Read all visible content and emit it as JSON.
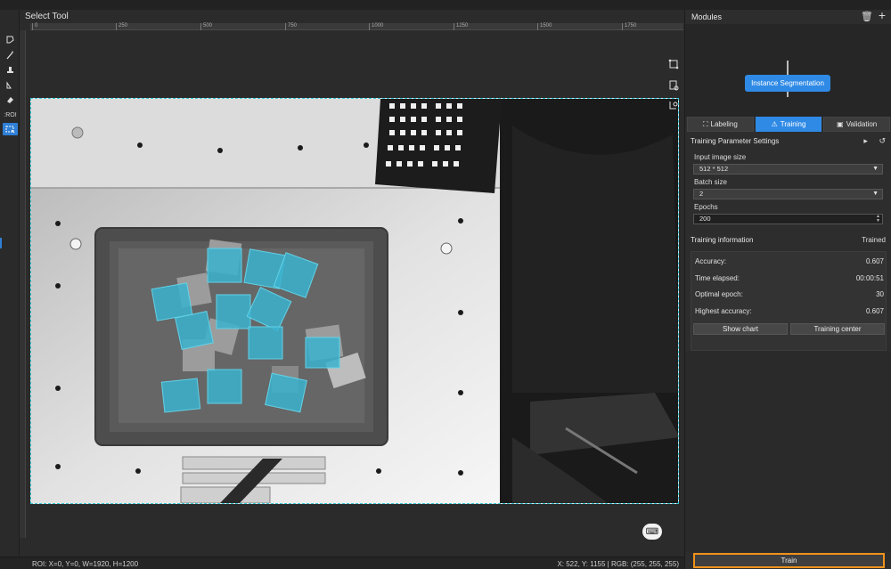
{
  "canvas": {
    "title": "Select Tool",
    "ruler_ticks": [
      "0",
      "250",
      "500",
      "750",
      "1000",
      "1250",
      "1500",
      "1750"
    ],
    "roi_marker": ":ROI"
  },
  "status": {
    "roi": "ROI: X=0, Y=0, W=1920, H=1200",
    "cursor": "X: 522, Y: 1155 | RGB: (255, 255, 255)"
  },
  "panel": {
    "title": "Modules",
    "module_node": "Instance Segmentation",
    "tabs": [
      {
        "label": "Labeling",
        "icon": "labeling-icon"
      },
      {
        "label": "Training",
        "icon": "training-icon"
      },
      {
        "label": "Validation",
        "icon": "validation-icon"
      }
    ],
    "params": {
      "header": "Training Parameter Settings",
      "input_size_label": "Input image size",
      "input_size_value": "512 * 512",
      "batch_label": "Batch size",
      "batch_value": "2",
      "epochs_label": "Epochs",
      "epochs_value": "200"
    },
    "info": {
      "header": "Training information",
      "status": "Trained",
      "rows": [
        {
          "k": "Accuracy:",
          "v": "0.607"
        },
        {
          "k": "Time elapsed:",
          "v": "00:00:51"
        },
        {
          "k": "Optimal epoch:",
          "v": "30"
        },
        {
          "k": "Highest accuracy:",
          "v": "0.607"
        }
      ],
      "show_chart": "Show chart",
      "training_center": "Training center"
    },
    "train_button": "Train"
  },
  "colors": {
    "accent": "#2f8ae6",
    "highlight": "#f0921b",
    "roi_border": "#3ac7d4",
    "mask": "#3bb3cf"
  }
}
